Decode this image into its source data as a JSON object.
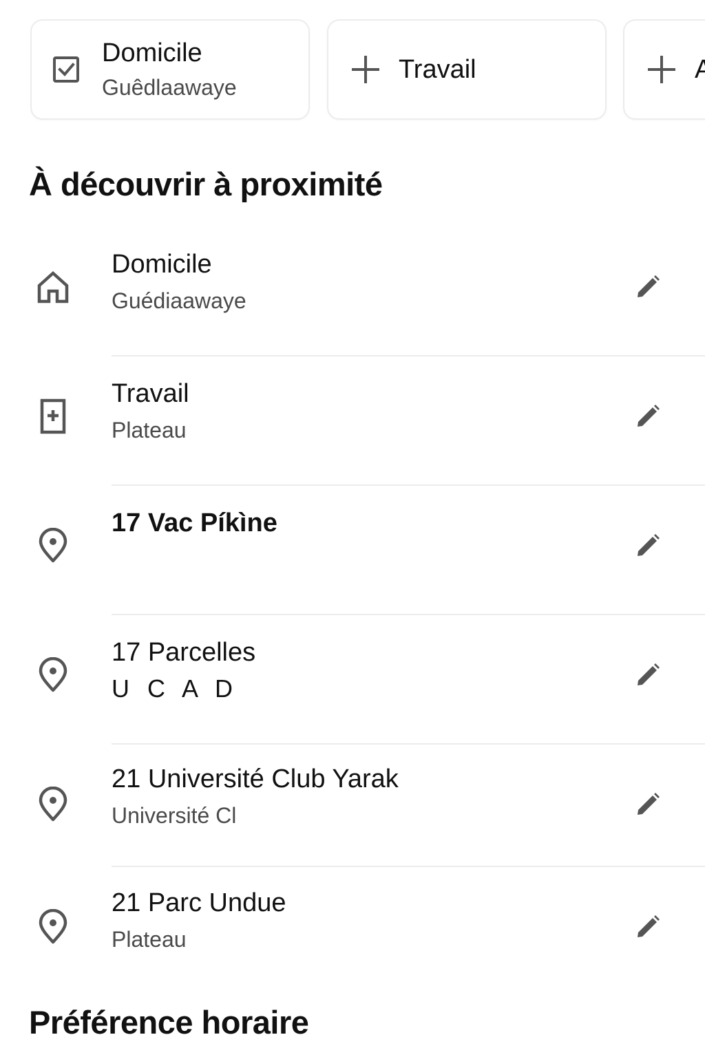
{
  "shortcuts": [
    {
      "title": "Domicile",
      "subtitle": "Guêdlaawaye",
      "icon": "checkbox-icon"
    },
    {
      "title": "Travail",
      "icon": "plus-icon"
    },
    {
      "title": "A",
      "icon": "plus-icon"
    }
  ],
  "sections": {
    "nearby_title": "À découvrir à proximité",
    "time_pref_title": "Préférence horaire"
  },
  "places": [
    {
      "name": "Domicile",
      "address": "Guédiaawaye",
      "icon": "home-icon",
      "edit_icon": "pencil-icon"
    },
    {
      "name": "Travail",
      "address": "Plateau",
      "icon": "office-building-icon",
      "edit_icon": "pencil-icon"
    },
    {
      "name": "17 Vac Píkìne",
      "address": "",
      "icon": "location-pin-icon",
      "edit_icon": "pencil-icon"
    },
    {
      "name": "17 Parcelles",
      "address": "U C A D",
      "icon": "location-pin-icon",
      "edit_icon": "pencil-icon"
    },
    {
      "name": "21 Université Club Yarak",
      "address": "Université Cl",
      "icon": "location-pin-icon",
      "edit_icon": "pencil-icon"
    },
    {
      "name": "21 Parc Undue",
      "address": "Plateau",
      "icon": "location-pin-icon",
      "edit_icon": "pencil-icon"
    }
  ],
  "colors": {
    "text_primary": "#111111",
    "text_secondary": "#4a4a4a",
    "icon": "#555555",
    "border": "#ececec",
    "background": "#ffffff"
  }
}
